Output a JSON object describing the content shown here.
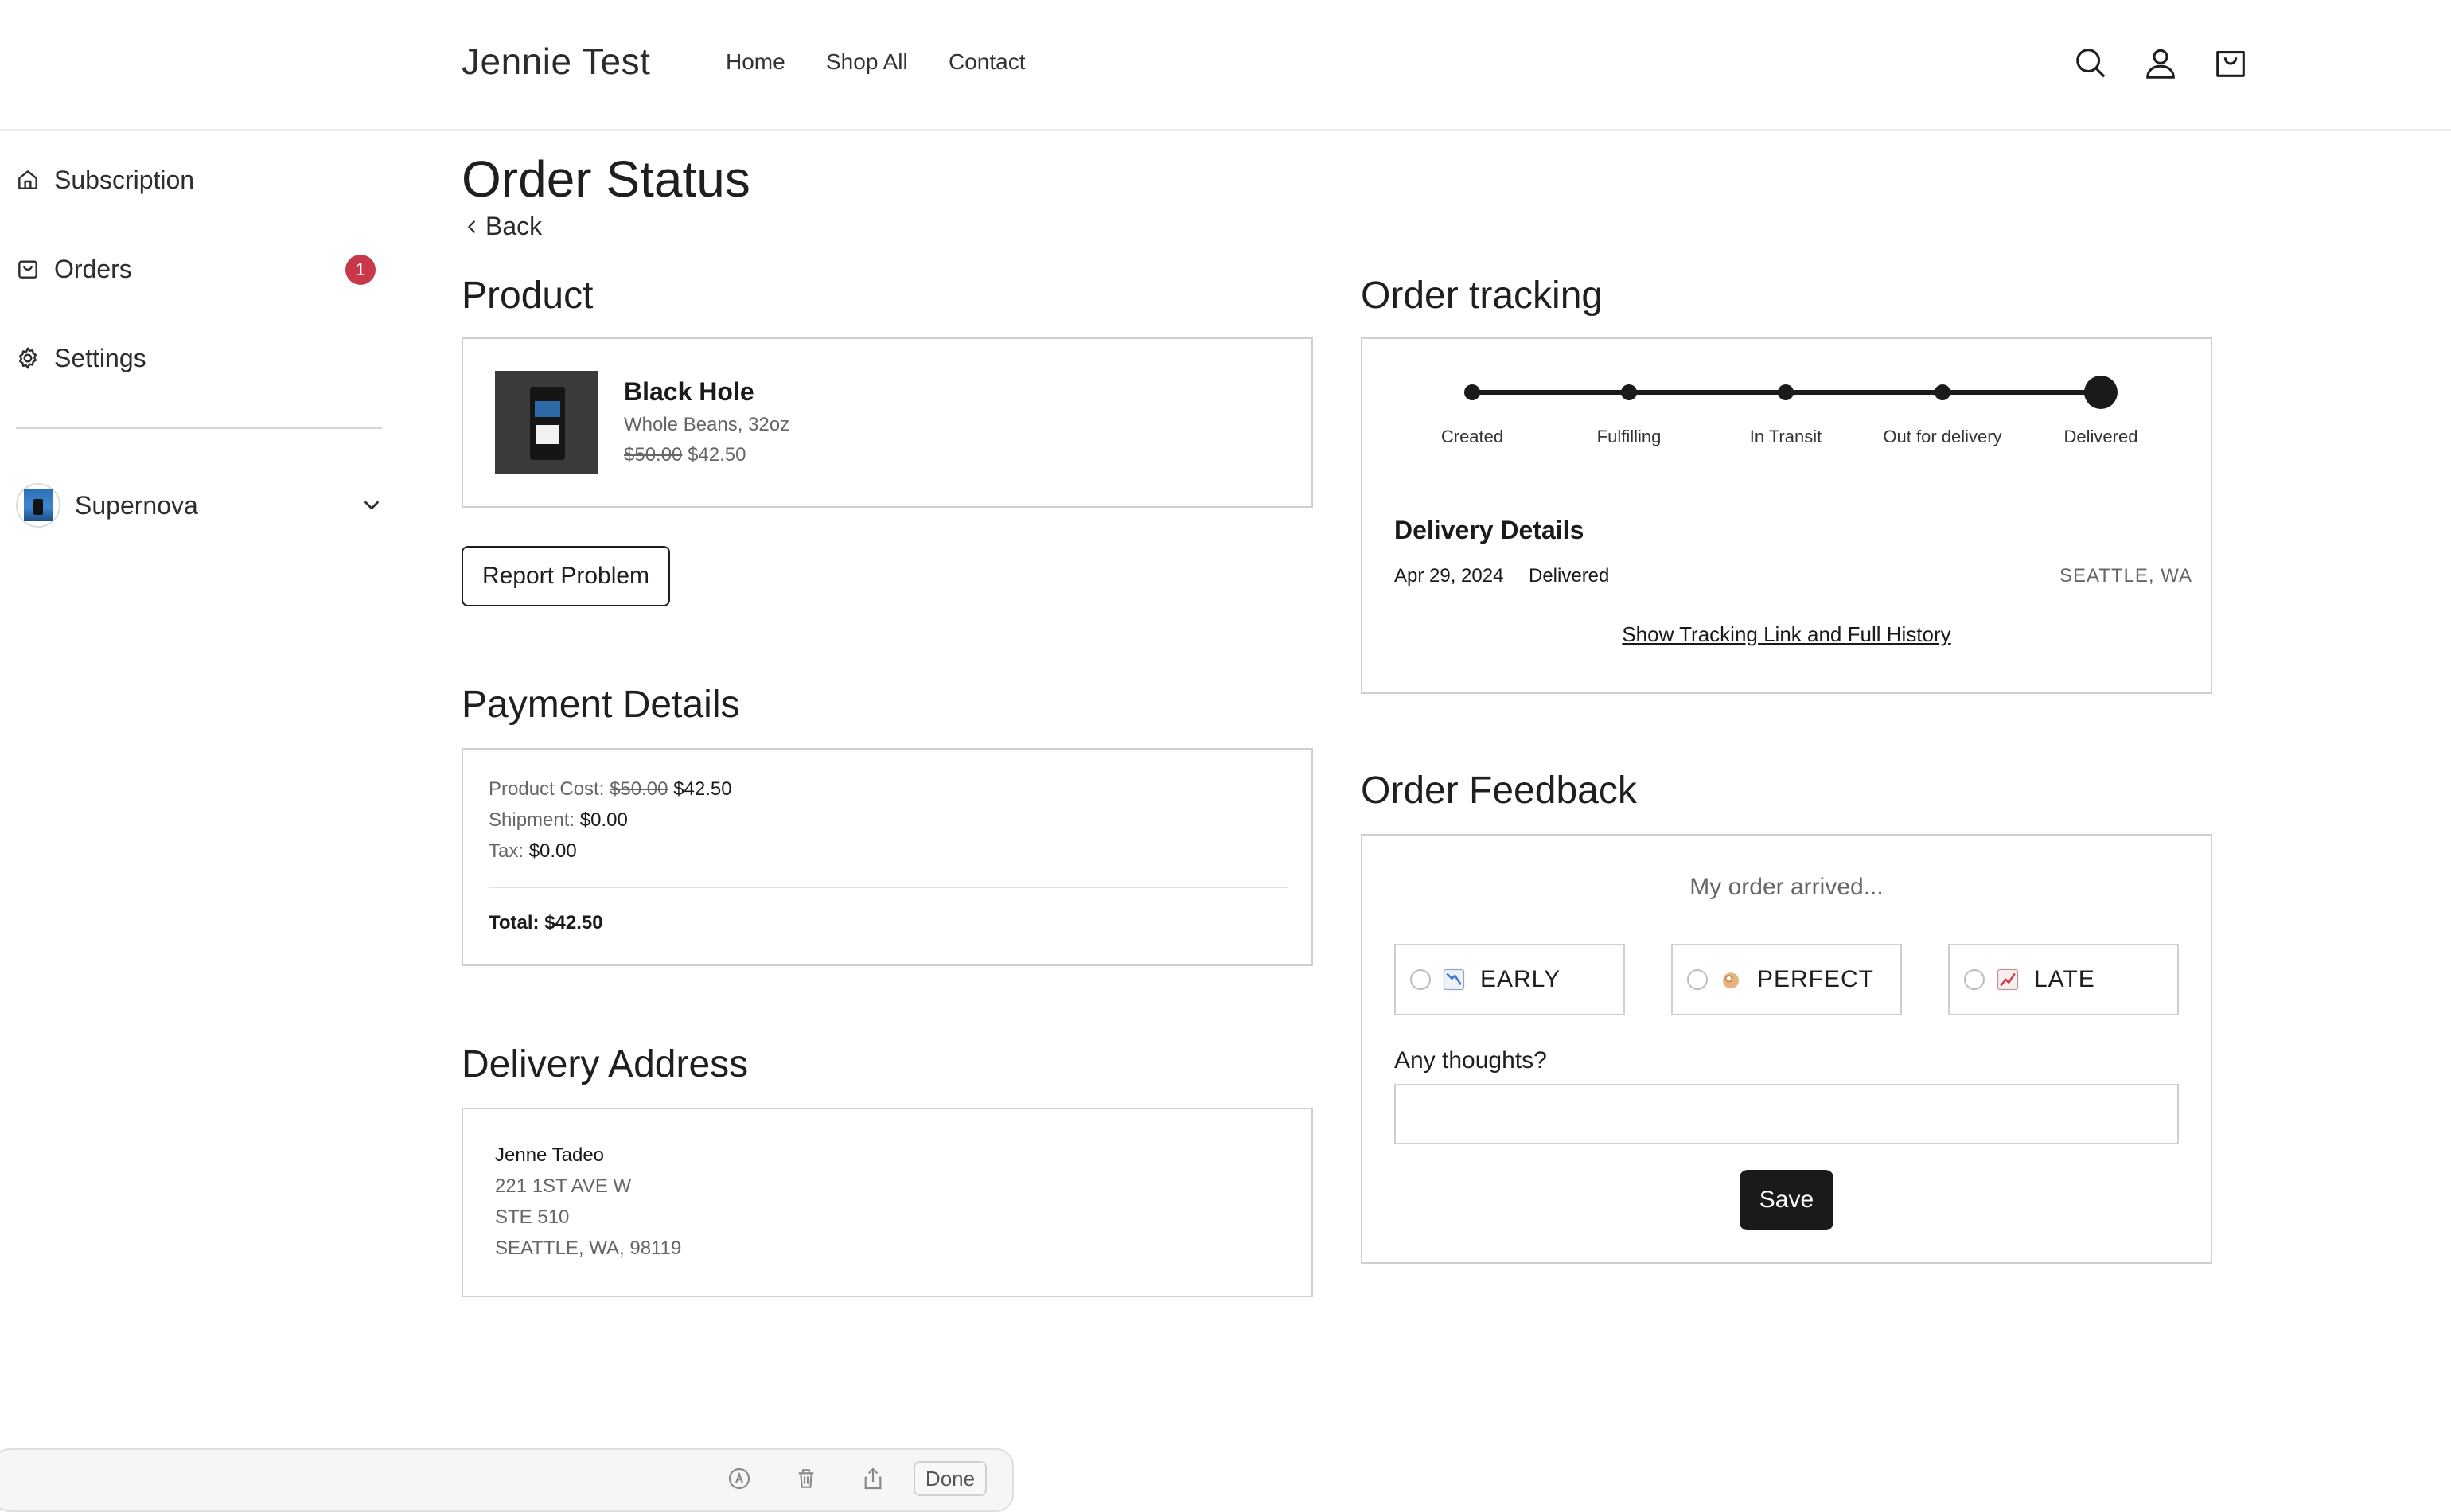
{
  "header": {
    "store_title": "Jennie Test",
    "nav": [
      "Home",
      "Shop All",
      "Contact"
    ]
  },
  "sidebar": {
    "items": [
      {
        "label": "Subscription",
        "icon": "home-icon"
      },
      {
        "label": "Orders",
        "icon": "bag-icon",
        "badge": "1"
      },
      {
        "label": "Settings",
        "icon": "gear-icon"
      }
    ],
    "subscription_select": "Supernova"
  },
  "page": {
    "title": "Order Status",
    "back_label": "Back"
  },
  "product": {
    "section_title": "Product",
    "name": "Black Hole",
    "variant": "Whole Beans, 32oz",
    "original_price": "$50.00",
    "price": "$42.50",
    "report_button": "Report Problem"
  },
  "payment": {
    "section_title": "Payment Details",
    "product_cost_label": "Product Cost:",
    "product_cost_original": "$50.00",
    "product_cost": "$42.50",
    "shipment_label": "Shipment:",
    "shipment": "$0.00",
    "tax_label": "Tax:",
    "tax": "$0.00",
    "total": "Total: $42.50"
  },
  "address": {
    "section_title": "Delivery Address",
    "lines": [
      "Jenne Tadeo",
      "221 1ST AVE W",
      "STE 510",
      "SEATTLE, WA, 98119"
    ]
  },
  "tracking": {
    "section_title": "Order tracking",
    "steps": [
      "Created",
      "Fulfilling",
      "In Transit",
      "Out for delivery",
      "Delivered"
    ],
    "current_step": 4,
    "details_title": "Delivery Details",
    "date": "Apr 29, 2024",
    "status": "Delivered",
    "location": "SEATTLE, WA",
    "link_label": "Show Tracking Link and Full History"
  },
  "feedback": {
    "section_title": "Order Feedback",
    "prompt": "My order arrived...",
    "options": [
      {
        "label": "EARLY",
        "icon": "chart-decreasing-icon"
      },
      {
        "label": "PERFECT",
        "icon": "ok-hand-icon"
      },
      {
        "label": "LATE",
        "icon": "chart-increasing-icon"
      }
    ],
    "thoughts_label": "Any thoughts?",
    "thoughts_value": "",
    "save_label": "Save"
  },
  "toolbar": {
    "done_label": "Done"
  },
  "colors": {
    "badge": "#c8374a",
    "primary_button": "#1a1a1a"
  }
}
